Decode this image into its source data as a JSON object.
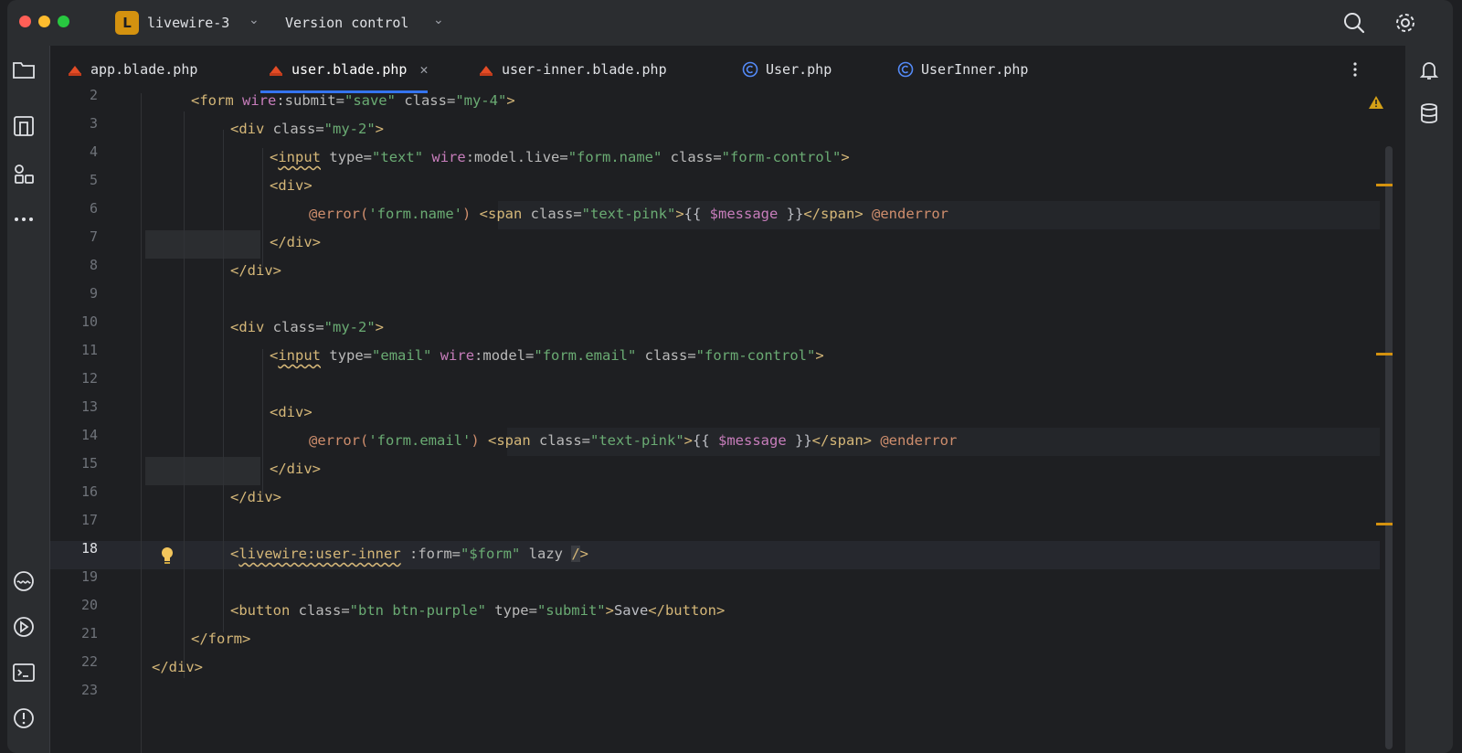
{
  "titlebar": {
    "project_initial": "L",
    "project_name": "livewire-3",
    "vcs_label": "Version control"
  },
  "tabs": [
    {
      "label": "app.blade.php",
      "type": "blade"
    },
    {
      "label": "user.blade.php",
      "type": "blade",
      "active": true
    },
    {
      "label": "user-inner.blade.php",
      "type": "blade"
    },
    {
      "label": "User.php",
      "type": "php-class"
    },
    {
      "label": "UserInner.php",
      "type": "php-class"
    }
  ],
  "editor": {
    "current_line": 18,
    "line_numbers": [
      "2",
      "3",
      "4",
      "5",
      "6",
      "7",
      "8",
      "9",
      "10",
      "11",
      "12",
      "13",
      "14",
      "15",
      "16",
      "17",
      "18",
      "19",
      "20",
      "21",
      "22",
      "23"
    ]
  },
  "colors": {
    "accent": "#3574f0",
    "tag": "#d5b778",
    "string": "#6aab73",
    "directive": "#cf8e6d",
    "variable": "#c77dbb"
  },
  "icons": {
    "left": [
      "folder-icon",
      "structure-icon",
      "plugins-icon",
      "more-icon",
      "livewire-icon",
      "run-icon",
      "terminal-icon",
      "problems-icon"
    ],
    "right": [
      "notifications-icon",
      "database-icon"
    ],
    "titlebar": [
      "search-icon",
      "gear-icon"
    ]
  }
}
